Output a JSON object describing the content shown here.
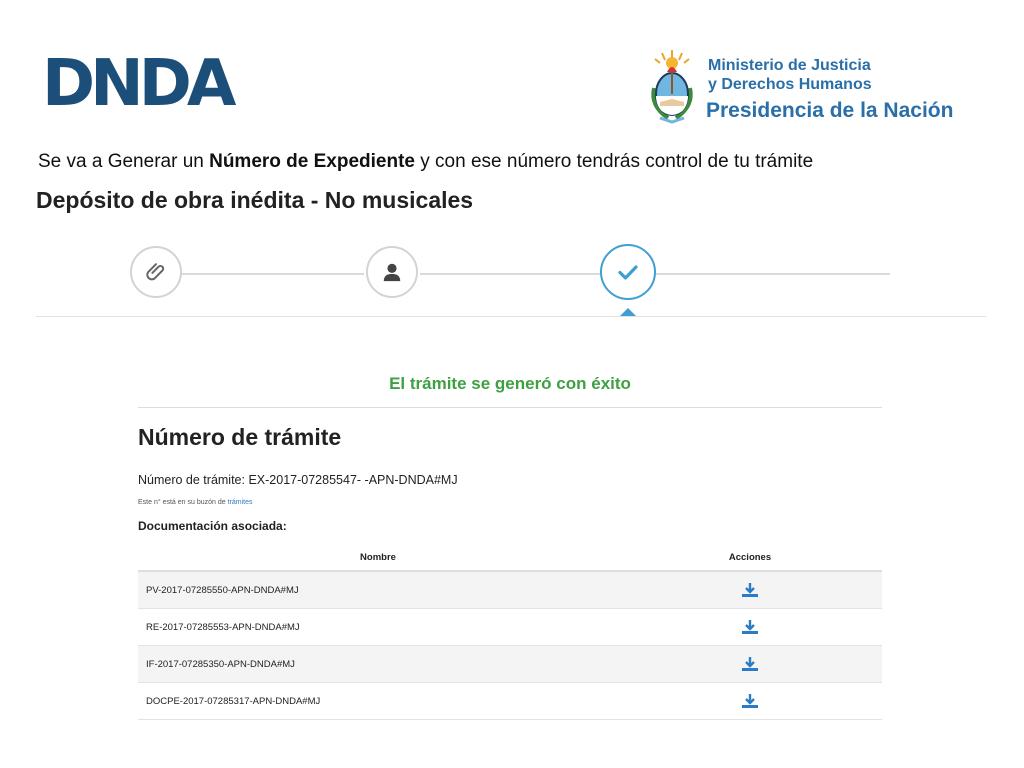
{
  "header": {
    "logo_text": "DNDA",
    "ministry_line1": "Ministerio de Justicia",
    "ministry_line2": "y Derechos Humanos",
    "ministry_line3": "Presidencia de la Nación"
  },
  "intro": {
    "before": "Se va a Generar un ",
    "bold": "Número de Expediente",
    "after": " y con ese número tendrás control de tu trámite"
  },
  "page_heading": "Depósito de obra inédita - No musicales",
  "stepper": {
    "steps": [
      {
        "icon": "paperclip-icon",
        "state": "done"
      },
      {
        "icon": "user-icon",
        "state": "done"
      },
      {
        "icon": "check-icon",
        "state": "active"
      }
    ],
    "accent_color": "#3f9fd1"
  },
  "result": {
    "success_message": "El trámite se generó con éxito",
    "success_color": "#3ea043",
    "title": "Número de trámite",
    "tramite_label": "Número de trámite: ",
    "tramite_value": "EX-2017-07285547- -APN-DNDA#MJ",
    "buzon_text": "Este n° está en su buzón de ",
    "buzon_link": "trámites",
    "documents_heading": "Documentación asociada:",
    "table": {
      "columns": [
        "Nombre",
        "Acciones"
      ],
      "rows": [
        {
          "name": "PV-2017-07285550-APN-DNDA#MJ",
          "action": "download-icon"
        },
        {
          "name": "RE-2017-07285553-APN-DNDA#MJ",
          "action": "download-icon"
        },
        {
          "name": "IF-2017-07285350-APN-DNDA#MJ",
          "action": "download-icon"
        },
        {
          "name": "DOCPE-2017-07285317-APN-DNDA#MJ",
          "action": "download-icon"
        }
      ]
    }
  },
  "colors": {
    "brand": "#1b4f7a",
    "ministry": "#2a6fa8",
    "link": "#2a7cc7"
  }
}
